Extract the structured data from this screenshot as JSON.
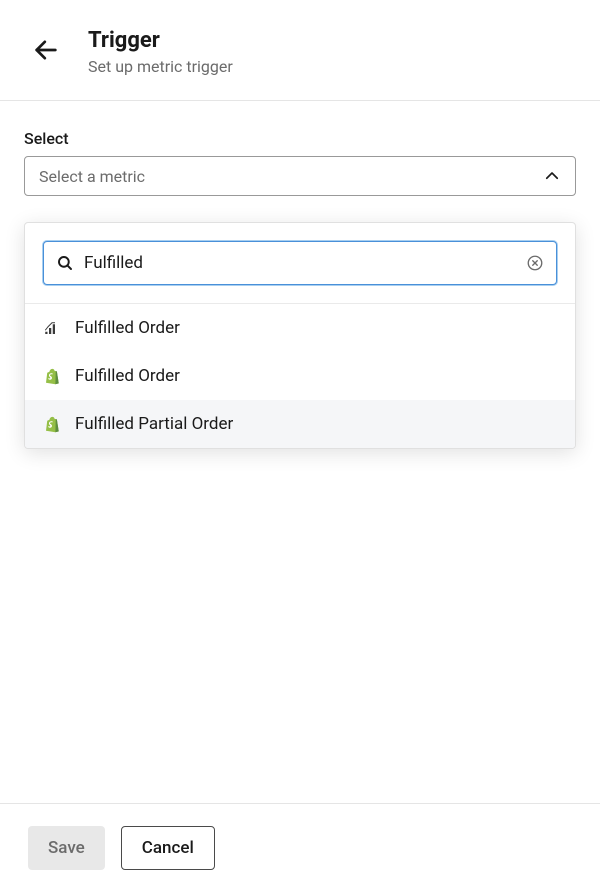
{
  "header": {
    "title": "Trigger",
    "subtitle": "Set up metric trigger"
  },
  "field": {
    "label": "Select",
    "placeholder": "Select a metric"
  },
  "search": {
    "value": "Fulfilled",
    "placeholder": ""
  },
  "options": [
    {
      "label": "Fulfilled Order",
      "icon": "metric"
    },
    {
      "label": "Fulfilled Order",
      "icon": "shopify"
    },
    {
      "label": "Fulfilled Partial Order",
      "icon": "shopify"
    }
  ],
  "footer": {
    "save_label": "Save",
    "cancel_label": "Cancel"
  }
}
